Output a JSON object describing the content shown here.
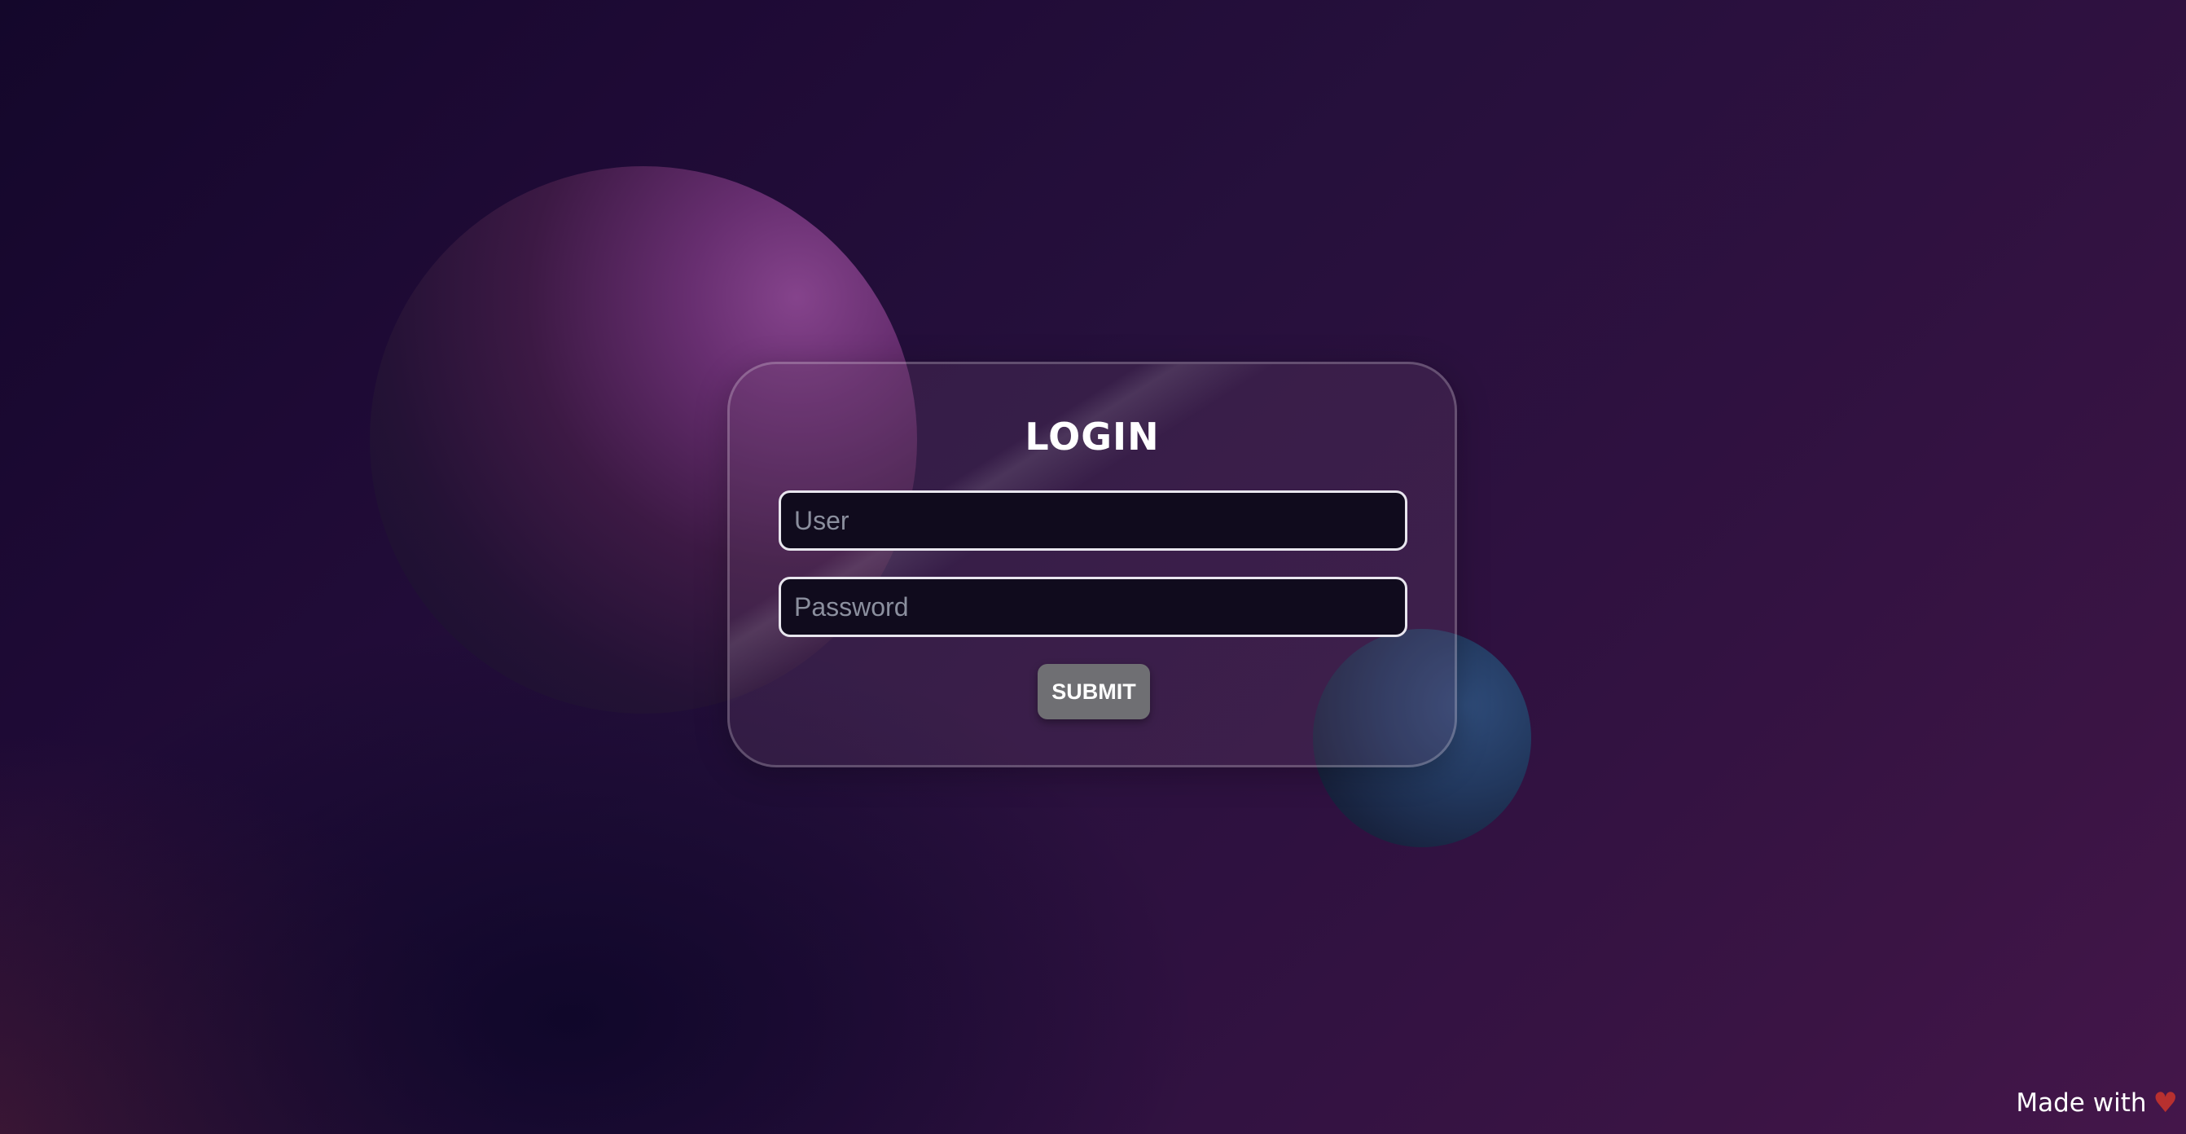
{
  "login": {
    "title": "LOGIN",
    "user_placeholder": "User",
    "user_value": "",
    "password_placeholder": "Password",
    "password_value": "",
    "submit_label": "SUBMIT"
  },
  "footer": {
    "text": "Made with",
    "icon": "heart-icon"
  },
  "colors": {
    "accent_heart": "#b8302f",
    "button_bg": "#6f6f73",
    "input_bg": "#100b1d"
  }
}
